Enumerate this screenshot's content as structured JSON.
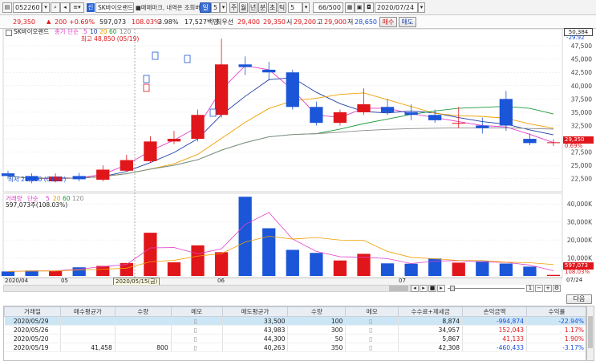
{
  "toolbar": {
    "code": "052260",
    "tag": "신",
    "name_short": "SK바이오랜드",
    "ticker_msg": "■매매마크, 내역은 조회버튼 클릭",
    "period_selected": "일",
    "period_value": "5",
    "periods": [
      "주",
      "월",
      "년",
      "분",
      "초",
      "틱"
    ],
    "count_value": "5",
    "page": "66/500",
    "date": "2020/07/24"
  },
  "quote": {
    "price": "29,350",
    "change_arrow": "▲",
    "change": "200",
    "change_pct": "+0.69%",
    "volume": "597,073",
    "vol_pct": "108.03%",
    "turnover": "3.98%",
    "amount": "17,527백만",
    "best_label": "최우선",
    "best_ask": "29,400",
    "best_bid": "29,350",
    "open_label": "시",
    "open": "29,200",
    "high_label": "고",
    "high": "29,900",
    "low_label": "저",
    "low": "28,650",
    "buy_label": "매수",
    "sell_label": "매도"
  },
  "price_panel": {
    "legend_name": "SK바이오랜드",
    "legend_ma": "종가 단순",
    "ma_periods": [
      "5",
      "10",
      "20",
      "60",
      "120"
    ],
    "ma_colors": [
      "#e040c8",
      "#1f3fa8",
      "#f0a000",
      "#1e9b3a",
      "#8a8a8a"
    ],
    "high_note": "최고 48,850 (05/19)",
    "low_note": "최저 21,650 (04/21)",
    "cur_box": "50,384",
    "cur_price_tag": "29,350",
    "cur_pct_tag": "0.69%",
    "top_tag": "-29.92",
    "y_ticks": [
      "47,500",
      "45,000",
      "42,500",
      "40,000",
      "37,500",
      "35,000",
      "32,500",
      "30,000",
      "27,500",
      "25,000",
      "22,500"
    ],
    "colors": {
      "up": "#e0161b",
      "down": "#1b55d8"
    }
  },
  "volume_panel": {
    "legend_name": "거래량",
    "legend_ma": "단순",
    "ma_periods": [
      "5",
      "20",
      "60",
      "120"
    ],
    "value_note": "597,073주(108.03%)",
    "y_ticks": [
      "40,000K",
      "30,000K",
      "20,000K",
      "10,000K"
    ],
    "cur_tag": "597,073",
    "pct_tag": "108.03%"
  },
  "x_axis": {
    "labels": [
      "2020/04",
      "05",
      "06",
      "07"
    ],
    "crosshair_label": "2020/05/15(금)",
    "end_label": "07/24"
  },
  "chart_data": {
    "type": "candlestick",
    "x": [
      "04/01",
      "04/06",
      "04/10",
      "04/14",
      "04/21",
      "04/24",
      "04/29",
      "05/06",
      "05/11",
      "05/15",
      "05/19",
      "05/21",
      "05/26",
      "06/01",
      "06/05",
      "06/11",
      "06/17",
      "06/23",
      "06/29",
      "07/03",
      "07/09",
      "07/15",
      "07/21",
      "07/24"
    ],
    "open": [
      23500,
      23000,
      22000,
      23000,
      22300,
      24000,
      25800,
      29500,
      30000,
      34500,
      44000,
      43000,
      42500,
      36000,
      33000,
      35000,
      36000,
      35000,
      34500,
      33000,
      32500,
      37500,
      30000,
      29200
    ],
    "close": [
      23000,
      22100,
      22900,
      22400,
      24200,
      26000,
      29500,
      30000,
      34500,
      44000,
      43500,
      42500,
      36000,
      33000,
      35000,
      36500,
      35000,
      34500,
      33500,
      33000,
      32000,
      32500,
      29200,
      29350
    ],
    "high": [
      24000,
      23500,
      23500,
      23600,
      25000,
      27000,
      30500,
      31500,
      35500,
      48850,
      45500,
      44500,
      43000,
      37000,
      35500,
      39500,
      37500,
      36500,
      35500,
      36000,
      34000,
      39000,
      31000,
      29900
    ],
    "low": [
      22500,
      21650,
      21800,
      22000,
      22000,
      23800,
      25500,
      29000,
      29500,
      34000,
      42000,
      41000,
      35500,
      32500,
      32500,
      34500,
      34500,
      33500,
      33000,
      32000,
      31000,
      31500,
      28800,
      28650
    ],
    "volume": [
      2500,
      3000,
      2800,
      4800,
      5600,
      7200,
      24000,
      7600,
      17000,
      13200,
      44000,
      26500,
      14500,
      12800,
      8600,
      12300,
      7000,
      6800,
      9700,
      7400,
      8200,
      6900,
      5200,
      597
    ],
    "volume_unit": "K",
    "y_range": [
      20500,
      50384
    ],
    "volume_range": [
      0,
      45000
    ],
    "grid": true
  },
  "nav": {
    "zoom_label": "1",
    "refresh_label": "다음"
  },
  "table": {
    "headers": [
      "거래일",
      "매수평균가",
      "수량",
      "메모",
      "매도평균가",
      "수량",
      "메모",
      "수수료+제세금",
      "손익금액",
      "수익률"
    ],
    "rows": [
      {
        "date": "2020/05/29",
        "buy_avg": "",
        "buy_qty": "",
        "sell_avg": "33,500",
        "sell_qty": "100",
        "fee": "8,874",
        "pnl": "-994,874",
        "ret": "-22.94%",
        "selected": true
      },
      {
        "date": "2020/05/26",
        "buy_avg": "",
        "buy_qty": "",
        "sell_avg": "43,983",
        "sell_qty": "300",
        "fee": "34,957",
        "pnl": "152,043",
        "ret": "1.17%",
        "selected": false
      },
      {
        "date": "2020/05/20",
        "buy_avg": "",
        "buy_qty": "",
        "sell_avg": "44,300",
        "sell_qty": "50",
        "fee": "5,867",
        "pnl": "41,133",
        "ret": "1.90%",
        "selected": false
      },
      {
        "date": "2020/05/19",
        "buy_avg": "41,458",
        "buy_qty": "800",
        "sell_avg": "40,263",
        "sell_qty": "350",
        "fee": "42,308",
        "pnl": "-460,433",
        "ret": "-3.17%",
        "selected": false
      }
    ]
  }
}
